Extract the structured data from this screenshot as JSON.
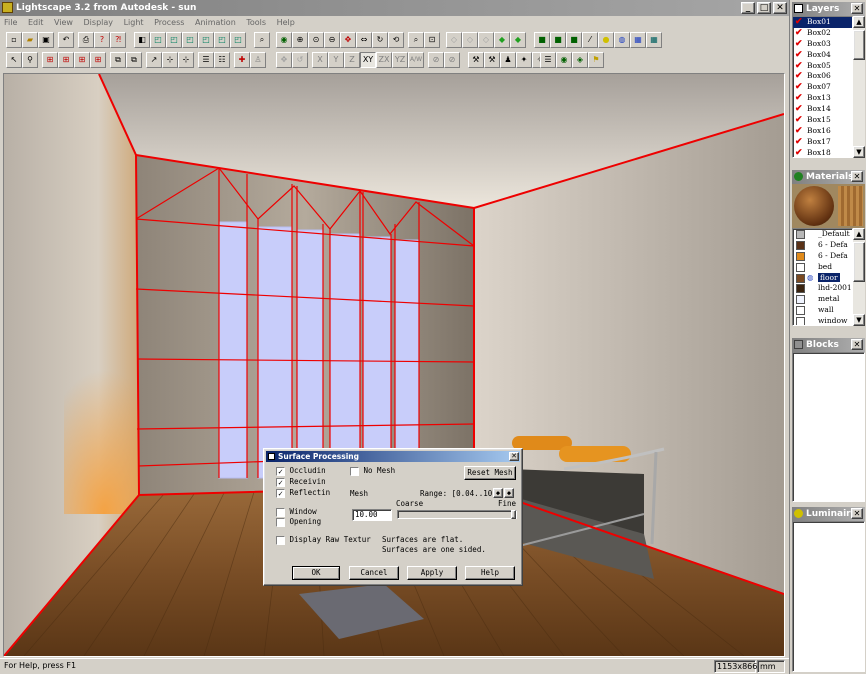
{
  "app": {
    "title": "Lightscape 3.2 from Autodesk - sun",
    "menu": [
      "File",
      "Edit",
      "View",
      "Display",
      "Light",
      "Process",
      "Animation",
      "Tools",
      "Help"
    ],
    "status_text": "For Help, press F1",
    "status_size": "1153x866",
    "status_unit": "mm"
  },
  "toolbar": {
    "axis_buttons": [
      "X",
      "Y",
      "Z",
      "XY",
      "ZX",
      "YZ",
      "A/W"
    ]
  },
  "layers": {
    "title": "Layers",
    "items": [
      "Box01",
      "Box02",
      "Box03",
      "Box04",
      "Box05",
      "Box06",
      "Box07",
      "Box13",
      "Box14",
      "Box15",
      "Box16",
      "Box17",
      "Box18"
    ],
    "selected": "Box01"
  },
  "materials": {
    "title": "Materials",
    "items": [
      {
        "name": "_Default",
        "color": "#b8b8b8"
      },
      {
        "name": "6 - Defa",
        "color": "#5a3218"
      },
      {
        "name": "6 - Defa",
        "color": "#e08a1a"
      },
      {
        "name": "bed",
        "color": "#ffffff"
      },
      {
        "name": "floor",
        "color": "#7a4a22"
      },
      {
        "name": "lhd-2001",
        "color": "#3a2410"
      },
      {
        "name": "metal",
        "color": "#f0f4ff"
      },
      {
        "name": "wall",
        "color": "#ffffff"
      },
      {
        "name": "window",
        "color": "#ffffff"
      }
    ],
    "selected": "floor"
  },
  "blocks": {
    "title": "Blocks"
  },
  "luminaires": {
    "title": "Luminaires"
  },
  "dialog": {
    "title": "Surface Processing",
    "occluding": "Occludin",
    "receiving": "Receivin",
    "reflecting": "Reflectin",
    "no_mesh": "No Mesh",
    "reset_mesh": "Reset Mesh",
    "mesh_label": "Mesh",
    "range_label": "Range: [0.04..10]",
    "coarse": "Coarse",
    "fine": "Fine",
    "mesh_value": "10.00",
    "window": "Window",
    "opening": "Opening",
    "display_raw": "Display Raw Textur",
    "info1": "Surfaces are flat.",
    "info2": "Surfaces are one sided.",
    "ok": "OK",
    "cancel": "Cancel",
    "apply": "Apply",
    "help": "Help"
  }
}
